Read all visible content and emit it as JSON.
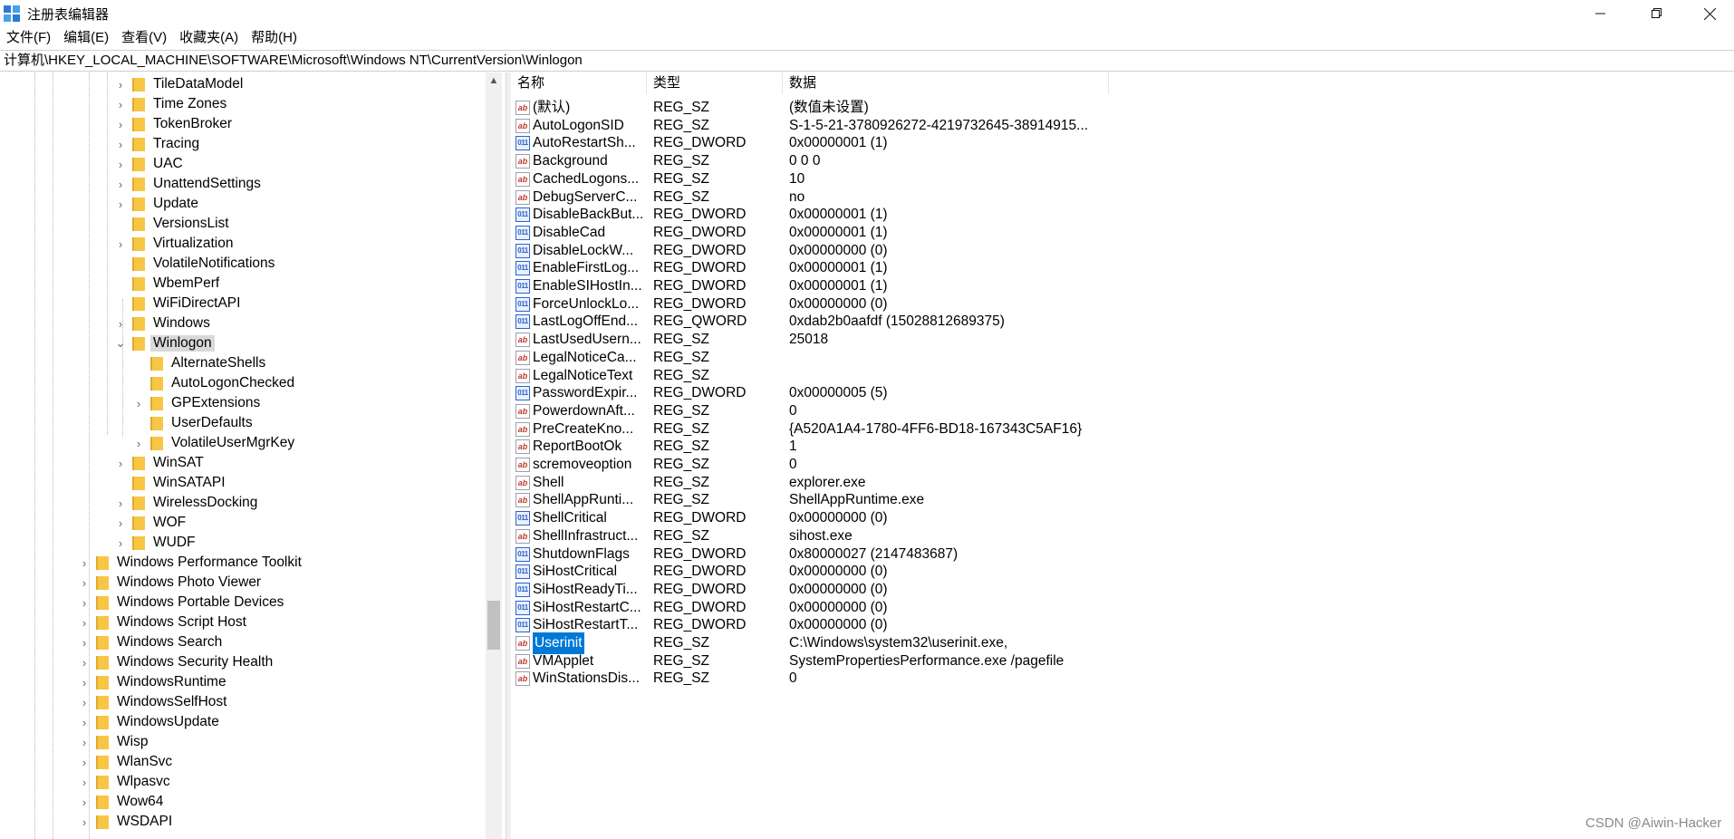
{
  "window": {
    "title": "注册表编辑器",
    "minimize_icon": "minimize-icon",
    "maximize_icon": "restore-icon",
    "close_icon": "close-icon"
  },
  "menu": [
    "文件(F)",
    "编辑(E)",
    "查看(V)",
    "收藏夹(A)",
    "帮助(H)"
  ],
  "address": "计算机\\HKEY_LOCAL_MACHINE\\SOFTWARE\\Microsoft\\Windows NT\\CurrentVersion\\Winlogon",
  "tree": [
    {
      "label": "TileDataModel",
      "depth": 2,
      "expand": "collapsed"
    },
    {
      "label": "Time Zones",
      "depth": 2,
      "expand": "collapsed"
    },
    {
      "label": "TokenBroker",
      "depth": 2,
      "expand": "collapsed"
    },
    {
      "label": "Tracing",
      "depth": 2,
      "expand": "collapsed"
    },
    {
      "label": "UAC",
      "depth": 2,
      "expand": "collapsed"
    },
    {
      "label": "UnattendSettings",
      "depth": 2,
      "expand": "collapsed"
    },
    {
      "label": "Update",
      "depth": 2,
      "expand": "collapsed"
    },
    {
      "label": "VersionsList",
      "depth": 2,
      "expand": "none"
    },
    {
      "label": "Virtualization",
      "depth": 2,
      "expand": "collapsed"
    },
    {
      "label": "VolatileNotifications",
      "depth": 2,
      "expand": "none"
    },
    {
      "label": "WbemPerf",
      "depth": 2,
      "expand": "none"
    },
    {
      "label": "WiFiDirectAPI",
      "depth": 2,
      "expand": "none"
    },
    {
      "label": "Windows",
      "depth": 2,
      "expand": "collapsed"
    },
    {
      "label": "Winlogon",
      "depth": 2,
      "expand": "expanded",
      "selected": true
    },
    {
      "label": "AlternateShells",
      "depth": 3,
      "expand": "none"
    },
    {
      "label": "AutoLogonChecked",
      "depth": 3,
      "expand": "none"
    },
    {
      "label": "GPExtensions",
      "depth": 3,
      "expand": "collapsed"
    },
    {
      "label": "UserDefaults",
      "depth": 3,
      "expand": "none"
    },
    {
      "label": "VolatileUserMgrKey",
      "depth": 3,
      "expand": "collapsed"
    },
    {
      "label": "WinSAT",
      "depth": 2,
      "expand": "collapsed"
    },
    {
      "label": "WinSATAPI",
      "depth": 2,
      "expand": "none"
    },
    {
      "label": "WirelessDocking",
      "depth": 2,
      "expand": "collapsed"
    },
    {
      "label": "WOF",
      "depth": 2,
      "expand": "collapsed"
    },
    {
      "label": "WUDF",
      "depth": 2,
      "expand": "collapsed"
    },
    {
      "label": "Windows Performance Toolkit",
      "depth": 1,
      "expand": "collapsed"
    },
    {
      "label": "Windows Photo Viewer",
      "depth": 1,
      "expand": "collapsed"
    },
    {
      "label": "Windows Portable Devices",
      "depth": 1,
      "expand": "collapsed"
    },
    {
      "label": "Windows Script Host",
      "depth": 1,
      "expand": "collapsed"
    },
    {
      "label": "Windows Search",
      "depth": 1,
      "expand": "collapsed"
    },
    {
      "label": "Windows Security Health",
      "depth": 1,
      "expand": "collapsed"
    },
    {
      "label": "WindowsRuntime",
      "depth": 1,
      "expand": "collapsed"
    },
    {
      "label": "WindowsSelfHost",
      "depth": 1,
      "expand": "collapsed"
    },
    {
      "label": "WindowsUpdate",
      "depth": 1,
      "expand": "collapsed"
    },
    {
      "label": "Wisp",
      "depth": 1,
      "expand": "collapsed"
    },
    {
      "label": "WlanSvc",
      "depth": 1,
      "expand": "collapsed"
    },
    {
      "label": "Wlpasvc",
      "depth": 1,
      "expand": "collapsed"
    },
    {
      "label": "Wow64",
      "depth": 1,
      "expand": "collapsed"
    },
    {
      "label": "WSDAPI",
      "depth": 1,
      "expand": "collapsed"
    }
  ],
  "columns": {
    "name": "名称",
    "type": "类型",
    "data": "数据"
  },
  "values": [
    {
      "name": "(默认)",
      "type": "REG_SZ",
      "data": "(数值未设置)",
      "icon": "string-value-icon"
    },
    {
      "name": "AutoLogonSID",
      "type": "REG_SZ",
      "data": "S-1-5-21-3780926272-4219732645-38914915...",
      "icon": "string-value-icon"
    },
    {
      "name": "AutoRestartSh...",
      "type": "REG_DWORD",
      "data": "0x00000001 (1)",
      "icon": "binary-value-icon"
    },
    {
      "name": "Background",
      "type": "REG_SZ",
      "data": "0 0 0",
      "icon": "string-value-icon"
    },
    {
      "name": "CachedLogons...",
      "type": "REG_SZ",
      "data": "10",
      "icon": "string-value-icon"
    },
    {
      "name": "DebugServerC...",
      "type": "REG_SZ",
      "data": "no",
      "icon": "string-value-icon"
    },
    {
      "name": "DisableBackBut...",
      "type": "REG_DWORD",
      "data": "0x00000001 (1)",
      "icon": "binary-value-icon"
    },
    {
      "name": "DisableCad",
      "type": "REG_DWORD",
      "data": "0x00000001 (1)",
      "icon": "binary-value-icon"
    },
    {
      "name": "DisableLockW...",
      "type": "REG_DWORD",
      "data": "0x00000000 (0)",
      "icon": "binary-value-icon"
    },
    {
      "name": "EnableFirstLog...",
      "type": "REG_DWORD",
      "data": "0x00000001 (1)",
      "icon": "binary-value-icon"
    },
    {
      "name": "EnableSIHostIn...",
      "type": "REG_DWORD",
      "data": "0x00000001 (1)",
      "icon": "binary-value-icon"
    },
    {
      "name": "ForceUnlockLo...",
      "type": "REG_DWORD",
      "data": "0x00000000 (0)",
      "icon": "binary-value-icon"
    },
    {
      "name": "LastLogOffEnd...",
      "type": "REG_QWORD",
      "data": "0xdab2b0aafdf (15028812689375)",
      "icon": "binary-value-icon"
    },
    {
      "name": "LastUsedUsern...",
      "type": "REG_SZ",
      "data": "25018",
      "icon": "string-value-icon"
    },
    {
      "name": "LegalNoticeCa...",
      "type": "REG_SZ",
      "data": "",
      "icon": "string-value-icon"
    },
    {
      "name": "LegalNoticeText",
      "type": "REG_SZ",
      "data": "",
      "icon": "string-value-icon"
    },
    {
      "name": "PasswordExpir...",
      "type": "REG_DWORD",
      "data": "0x00000005 (5)",
      "icon": "binary-value-icon"
    },
    {
      "name": "PowerdownAft...",
      "type": "REG_SZ",
      "data": "0",
      "icon": "string-value-icon"
    },
    {
      "name": "PreCreateKno...",
      "type": "REG_SZ",
      "data": "{A520A1A4-1780-4FF6-BD18-167343C5AF16}",
      "icon": "string-value-icon"
    },
    {
      "name": "ReportBootOk",
      "type": "REG_SZ",
      "data": "1",
      "icon": "string-value-icon"
    },
    {
      "name": "scremoveoption",
      "type": "REG_SZ",
      "data": "0",
      "icon": "string-value-icon"
    },
    {
      "name": "Shell",
      "type": "REG_SZ",
      "data": "explorer.exe",
      "icon": "string-value-icon"
    },
    {
      "name": "ShellAppRunti...",
      "type": "REG_SZ",
      "data": "ShellAppRuntime.exe",
      "icon": "string-value-icon"
    },
    {
      "name": "ShellCritical",
      "type": "REG_DWORD",
      "data": "0x00000000 (0)",
      "icon": "binary-value-icon"
    },
    {
      "name": "ShellInfrastruct...",
      "type": "REG_SZ",
      "data": "sihost.exe",
      "icon": "string-value-icon"
    },
    {
      "name": "ShutdownFlags",
      "type": "REG_DWORD",
      "data": "0x80000027 (2147483687)",
      "icon": "binary-value-icon"
    },
    {
      "name": "SiHostCritical",
      "type": "REG_DWORD",
      "data": "0x00000000 (0)",
      "icon": "binary-value-icon"
    },
    {
      "name": "SiHostReadyTi...",
      "type": "REG_DWORD",
      "data": "0x00000000 (0)",
      "icon": "binary-value-icon"
    },
    {
      "name": "SiHostRestartC...",
      "type": "REG_DWORD",
      "data": "0x00000000 (0)",
      "icon": "binary-value-icon"
    },
    {
      "name": "SiHostRestartT...",
      "type": "REG_DWORD",
      "data": "0x00000000 (0)",
      "icon": "binary-value-icon"
    },
    {
      "name": "Userinit",
      "type": "REG_SZ",
      "data": "C:\\Windows\\system32\\userinit.exe,",
      "icon": "string-value-icon",
      "selected": true
    },
    {
      "name": "VMApplet",
      "type": "REG_SZ",
      "data": "SystemPropertiesPerformance.exe /pagefile",
      "icon": "string-value-icon"
    },
    {
      "name": "WinStationsDis...",
      "type": "REG_SZ",
      "data": "0",
      "icon": "string-value-icon"
    }
  ],
  "watermark": "CSDN @Aiwin-Hacker",
  "colors": {
    "selection": "#0078d7",
    "folder": "#f6c644",
    "tree_selection": "#d9d9d9"
  }
}
